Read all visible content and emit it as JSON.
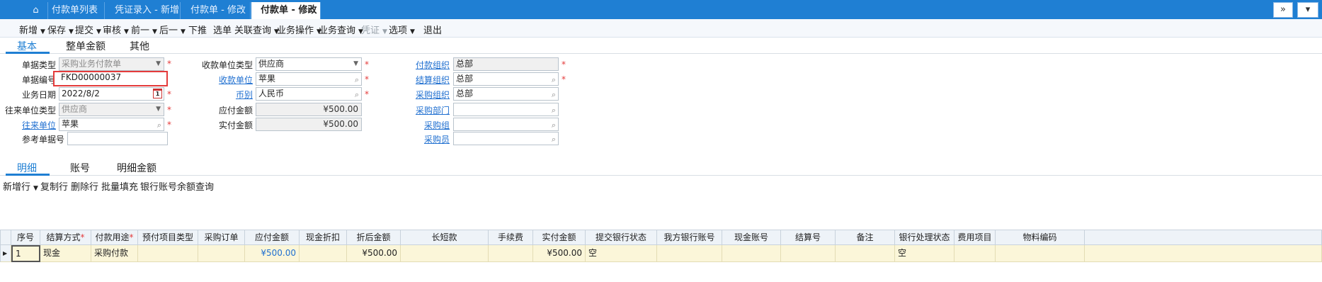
{
  "tabs": {
    "home_icon": "home-icon",
    "items": [
      {
        "label": "付款单列表"
      },
      {
        "label": "凭证录入 - 新增"
      },
      {
        "label": "付款单 - 修改"
      },
      {
        "label": "付款单 - 修改",
        "close": "×"
      }
    ],
    "right_icon": "»"
  },
  "toolbar": {
    "new": "新增",
    "save": "保存",
    "submit": "提交",
    "audit": "审核",
    "prev": "前一",
    "next": "后一",
    "push_down": "下推",
    "select_bill": "选单",
    "related_query": "关联查询",
    "biz_op": "业务操作",
    "biz_query": "业务查询",
    "voucher": "凭证",
    "options": "选项",
    "exit": "退出"
  },
  "section_tabs": [
    "基本",
    "整单金额",
    "其他"
  ],
  "form": {
    "bill_type_label": "单据类型",
    "bill_type": "采购业务付款单",
    "bill_no_label": "单据编号",
    "bill_no": "FKD00000037",
    "biz_date_label": "业务日期",
    "biz_date": "2022/8/2",
    "cal_day": "1",
    "contact_type_label": "往来单位类型",
    "contact_type": "供应商",
    "contact_unit_label": "往来单位",
    "contact_unit": "苹果",
    "ref_no_label": "参考单据号",
    "ref_no": "",
    "payee_type_label": "收款单位类型",
    "payee_type": "供应商",
    "payee_label": "收款单位",
    "payee": "苹果",
    "currency_label": "币别",
    "currency": "人民币",
    "payable_label": "应付金额",
    "payable": "¥500.00",
    "actual_label": "实付金额",
    "actual": "¥500.00",
    "pay_org_label": "付款组织",
    "pay_org": "总部",
    "settle_org_label": "结算组织",
    "settle_org": "总部",
    "purchase_org_label": "采购组织",
    "purchase_org": "总部",
    "purchase_dept_label": "采购部门",
    "purchase_dept": "",
    "purchase_group_label": "采购组",
    "purchase_group": "",
    "purchaser_label": "采购员",
    "purchaser": "",
    "required_mark": "*"
  },
  "detail_tabs": [
    "明细",
    "账号",
    "明细金额"
  ],
  "grid_toolbar": {
    "add_row": "新增行",
    "copy_row": "复制行",
    "delete_row": "删除行",
    "batch_fill": "批量填充",
    "bank_balance": "银行账号余额查询"
  },
  "grid": {
    "columns": [
      "序号",
      "结算方式",
      "付款用途",
      "预付项目类型",
      "采购订单",
      "应付金额",
      "现金折扣",
      "折后金额",
      "长短款",
      "手续费",
      "实付金额",
      "提交银行状态",
      "我方银行账号",
      "现金账号",
      "结算号",
      "备注",
      "银行处理状态",
      "费用项目",
      "物料编码"
    ],
    "rows": [
      {
        "seq": "1",
        "settle_method": "现金",
        "purpose": "采购付款",
        "prepay_type": "",
        "po": "",
        "payable": "¥500.00",
        "discount": "",
        "after_discount": "¥500.00",
        "long_short": "",
        "fee": "",
        "actual": "¥500.00",
        "bank_submit_status": "空",
        "our_bank_acct": "",
        "cash_acct": "",
        "settle_no": "",
        "remark": "",
        "bank_proc_status": "空",
        "expense_item": "",
        "material_code": ""
      }
    ]
  }
}
